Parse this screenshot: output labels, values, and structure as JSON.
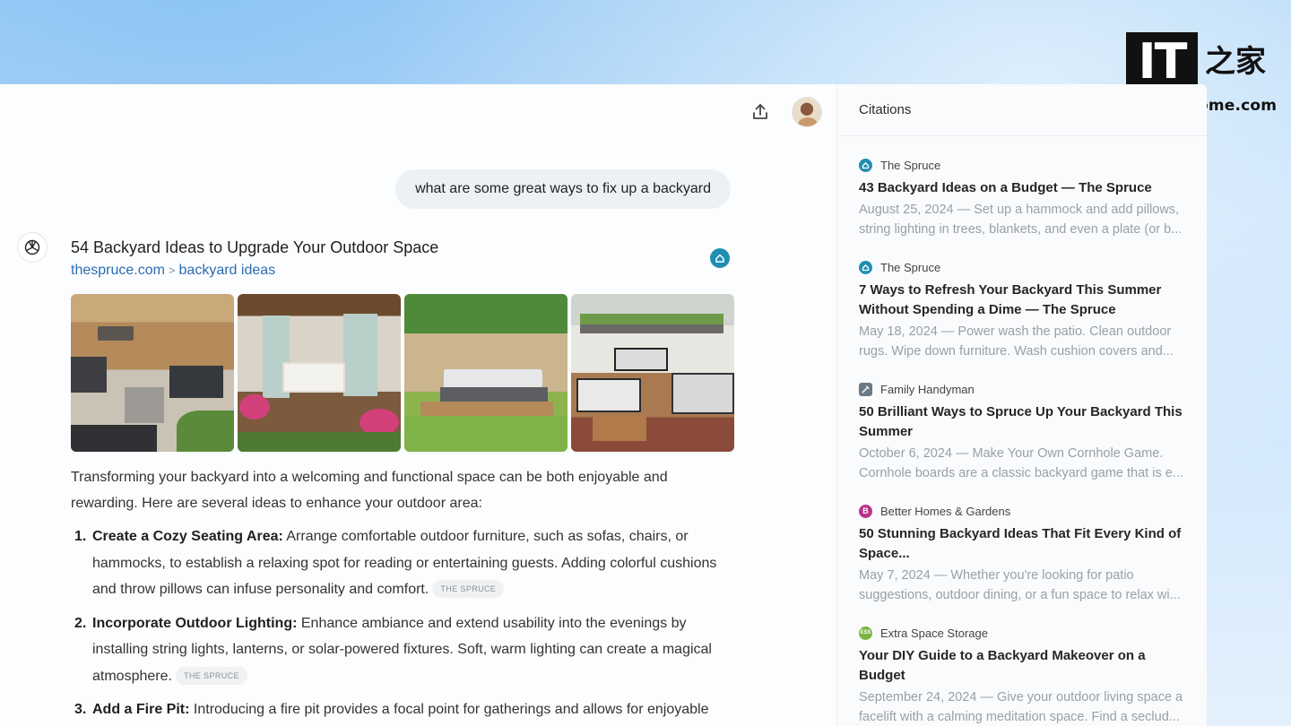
{
  "watermark": {
    "logo_it": "IT",
    "logo_char": "之家",
    "url": "www.ithome.com"
  },
  "header": {
    "share_icon": "share-upload-icon",
    "avatar": "user-avatar"
  },
  "chat": {
    "user_message": "what are some great ways to fix up a backyard",
    "result": {
      "title": "54 Backyard Ideas to Upgrade Your Outdoor Space",
      "domain": "thespruce.com",
      "path": "backyard ideas"
    },
    "intro": "Transforming your backyard into a welcoming and functional space can be both enjoyable and rewarding. Here are several ideas to enhance your outdoor area:",
    "ideas": [
      {
        "num": "1.",
        "heading": "Create a Cozy Seating Area:",
        "text": " Arrange comfortable outdoor furniture, such as sofas, chairs, or hammocks, to establish a relaxing spot for reading or entertaining guests. Adding colorful cushions and throw pillows can infuse personality and comfort.",
        "cite": "THE SPRUCE"
      },
      {
        "num": "2.",
        "heading": "Incorporate Outdoor Lighting:",
        "text": " Enhance ambiance and extend usability into the evenings by installing string lights, lanterns, or solar-powered fixtures. Soft, warm lighting can create a magical atmosphere.",
        "cite": "THE SPRUCE"
      },
      {
        "num": "3.",
        "heading": "Add a Fire Pit:",
        "text": " Introducing a fire pit provides a focal point for gatherings and allows for enjoyable",
        "cite": ""
      }
    ]
  },
  "citations": {
    "header": "Citations",
    "items": [
      {
        "source": "The Spruce",
        "favicon": "spruce",
        "title": "43 Backyard Ideas on a Budget — The Spruce",
        "snippet": "August 25, 2024 — Set up a hammock and add pillows, string lighting in trees, blankets, and even a plate (or b..."
      },
      {
        "source": "The Spruce",
        "favicon": "spruce",
        "title": "7 Ways to Refresh Your Backyard This Summer Without Spending a Dime — The Spruce",
        "snippet": "May 18, 2024 — Power wash the patio. Clean outdoor rugs. Wipe down furniture. Wash cushion covers and..."
      },
      {
        "source": "Family Handyman",
        "favicon": "fh",
        "title": "50 Brilliant Ways to Spruce Up Your Backyard This Summer",
        "snippet": "October 6, 2024 — Make Your Own Cornhole Game. Cornhole boards are a classic backyard game that is e..."
      },
      {
        "source": "Better Homes & Gardens",
        "favicon": "bhg",
        "title": "50 Stunning Backyard Ideas That Fit Every Kind of Space...",
        "snippet": "May 7, 2024 — Whether you're looking for patio suggestions, outdoor dining, or a fun space to relax wi..."
      },
      {
        "source": "Extra Space Storage",
        "favicon": "ess",
        "title": "Your DIY Guide to a Backyard Makeover on a Budget",
        "snippet": "September 24, 2024 — Give your outdoor living space a facelift with a calming meditation space. Find a seclud..."
      }
    ]
  },
  "colors": {
    "link": "#2b6cb0",
    "spruce": "#1f8fb0",
    "bhg": "#b8348a",
    "ess": "#7cb342"
  }
}
